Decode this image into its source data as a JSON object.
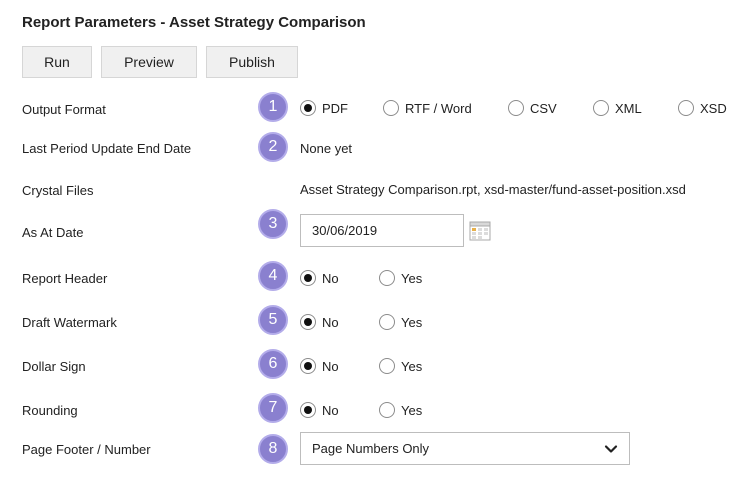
{
  "page": {
    "title": "Report Parameters - Asset Strategy Comparison"
  },
  "toolbar": {
    "run_label": "Run",
    "preview_label": "Preview",
    "publish_label": "Publish"
  },
  "fields": {
    "output_format": {
      "label": "Output Format",
      "badge": "1",
      "options": [
        "PDF",
        "RTF / Word",
        "CSV",
        "XML",
        "XSD"
      ],
      "selected": "PDF"
    },
    "last_period": {
      "label": "Last Period Update End Date",
      "badge": "2",
      "value": "None yet"
    },
    "crystal_files": {
      "label": "Crystal Files",
      "value": "Asset Strategy Comparison.rpt, xsd-master/fund-asset-position.xsd"
    },
    "as_at_date": {
      "label": "As At Date",
      "badge": "3",
      "value": "30/06/2019",
      "icon": "calendar-icon"
    },
    "report_header": {
      "label": "Report Header",
      "badge": "4",
      "options": [
        "No",
        "Yes"
      ],
      "selected": "No"
    },
    "draft_watermark": {
      "label": "Draft Watermark",
      "badge": "5",
      "options": [
        "No",
        "Yes"
      ],
      "selected": "No"
    },
    "dollar_sign": {
      "label": "Dollar Sign",
      "badge": "6",
      "options": [
        "No",
        "Yes"
      ],
      "selected": "No"
    },
    "rounding": {
      "label": "Rounding",
      "badge": "7",
      "options": [
        "No",
        "Yes"
      ],
      "selected": "No"
    },
    "page_footer": {
      "label": "Page Footer / Number",
      "badge": "8",
      "value": "Page Numbers Only",
      "icon": "chevron-down-icon"
    }
  },
  "colors": {
    "badge": "#8a80cf",
    "button_bg": "#f0f0f0"
  }
}
